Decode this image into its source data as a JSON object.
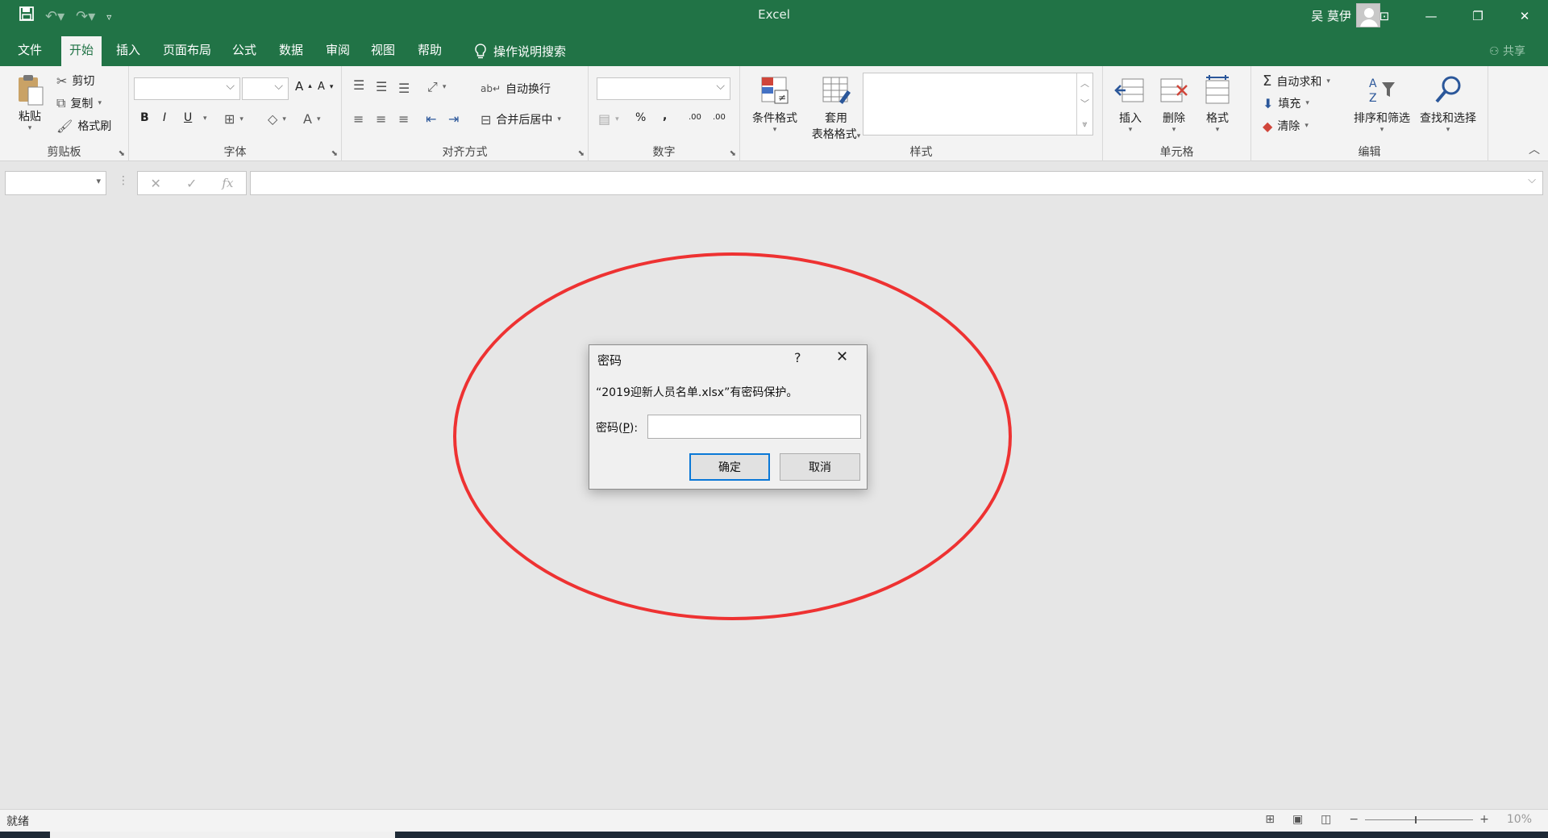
{
  "window": {
    "title": "Excel",
    "user_name": "吴 莫伊",
    "share_label": "共享"
  },
  "tabs": [
    {
      "label": "文件"
    },
    {
      "label": "开始",
      "active": true
    },
    {
      "label": "插入"
    },
    {
      "label": "页面布局"
    },
    {
      "label": "公式"
    },
    {
      "label": "数据"
    },
    {
      "label": "审阅"
    },
    {
      "label": "视图"
    },
    {
      "label": "帮助"
    },
    {
      "label": "操作说明搜索"
    }
  ],
  "ribbon": {
    "clipboard": {
      "label": "剪贴板",
      "paste": "粘贴",
      "cut": "剪切",
      "copy": "复制",
      "format_painter": "格式刷"
    },
    "font": {
      "label": "字体",
      "bold": "B",
      "italic": "I",
      "underline": "U",
      "grow": "A",
      "shrink": "A"
    },
    "alignment": {
      "label": "对齐方式",
      "wrap_text": "自动换行",
      "merge_center": "合并后居中"
    },
    "number": {
      "label": "数字",
      "percent": "%",
      "comma": ",",
      "inc_decimal": ".00",
      "dec_decimal": ".00"
    },
    "styles": {
      "label": "样式",
      "conditional": "条件格式",
      "table_format_1": "套用",
      "table_format_2": "表格格式"
    },
    "cells": {
      "label": "单元格",
      "insert": "插入",
      "delete": "删除",
      "format": "格式"
    },
    "editing": {
      "label": "编辑",
      "autosum": "自动求和",
      "fill": "填充",
      "clear": "清除",
      "sort_filter": "排序和筛选",
      "find_select": "查找和选择"
    }
  },
  "formula_bar": {
    "fx": "fx"
  },
  "dialog": {
    "title": "密码",
    "help": "?",
    "close": "✕",
    "message": "“2019迎新人员名单.xlsx”有密码保护。",
    "password_label_prefix": "密码(",
    "password_label_key": "P",
    "password_label_suffix": "):",
    "password_value": "",
    "ok": "确定",
    "cancel": "取消"
  },
  "annotation": {
    "color": "#ee3232",
    "shape": "ellipse"
  },
  "status": {
    "ready": "就绪",
    "zoom": "10%",
    "zoom_minus": "−",
    "zoom_plus": "+"
  },
  "colors": {
    "brand": "#217346",
    "ok_border": "#0a78d7"
  }
}
